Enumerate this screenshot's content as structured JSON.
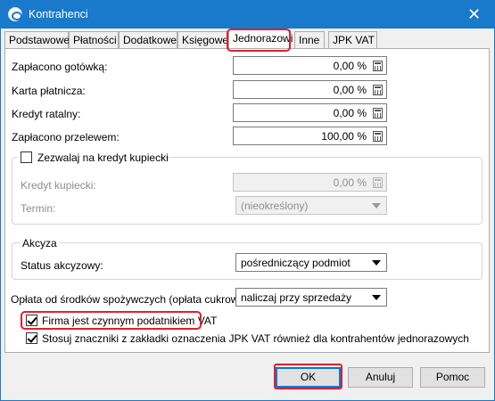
{
  "window": {
    "title": "Kontrahenci",
    "close_symbol": "✕"
  },
  "tabs": [
    {
      "label": "Podstawowe"
    },
    {
      "label": "Płatności"
    },
    {
      "label": "Dodatkowe"
    },
    {
      "label": "Księgowe"
    },
    {
      "label": "Jednorazowi",
      "active": true
    },
    {
      "label": "Inne"
    },
    {
      "label": "JPK VAT"
    }
  ],
  "payments": {
    "cash": {
      "label": "Zapłacono gotówką:",
      "value": "0,00 %"
    },
    "card": {
      "label": "Karta płatnicza:",
      "value": "0,00 %"
    },
    "installment": {
      "label": "Kredyt ratalny:",
      "value": "0,00 %"
    },
    "transfer": {
      "label": "Zapłacono przelewem:",
      "value": "100,00 %"
    }
  },
  "credit": {
    "allow_label": "Zezwalaj na kredyt kupiecki",
    "allow_checked": false,
    "credit_label": "Kredyt kupiecki:",
    "credit_value": "0,00 %",
    "term_label": "Termin:",
    "term_value": "(nieokreślony)"
  },
  "excise": {
    "group_label": "Akcyza",
    "status_label": "Status akcyzowy:",
    "status_value": "pośredniczący podmiot"
  },
  "sugar_fee": {
    "label": "Opłata od środków spożywczych (opłata cukrowa):",
    "value": "naliczaj przy sprzedaży"
  },
  "vat": {
    "active_payer_label": "Firma jest czynnym podatnikiem VAT",
    "active_payer_checked": true,
    "jpk_markers_label": "Stosuj znaczniki z zakładki oznaczenia JPK VAT również dla kontrahentów jednorazowych",
    "jpk_markers_checked": true
  },
  "buttons": {
    "ok": "OK",
    "cancel": "Anuluj",
    "help": "Pomoc"
  },
  "colors": {
    "titlebar": "#1979ca",
    "highlight": "#e0202a"
  }
}
